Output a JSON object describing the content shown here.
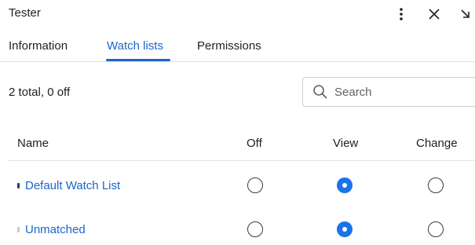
{
  "header": {
    "title": "Tester",
    "icons": {
      "menu": "more-vertical-icon",
      "close": "close-icon",
      "collapse": "collapse-arrow-icon"
    }
  },
  "tabs": [
    {
      "label": "Information",
      "active": false
    },
    {
      "label": "Watch lists",
      "active": true
    },
    {
      "label": "Permissions",
      "active": false
    }
  ],
  "summary": {
    "count_text": "2 total, 0 off"
  },
  "search": {
    "placeholder": "Search",
    "value": ""
  },
  "table": {
    "columns": {
      "name": "Name",
      "off": "Off",
      "view": "View",
      "change": "Change"
    },
    "rows": [
      {
        "name": "Default Watch List",
        "selected": "view",
        "marker_color": "#1a3f7a"
      },
      {
        "name": "Unmatched",
        "selected": "view",
        "marker_color": "#c9c9c9"
      }
    ]
  },
  "colors": {
    "accent": "#1a66c9",
    "radio_selected": "#1a73e8",
    "divider": "#e3e3e3"
  }
}
